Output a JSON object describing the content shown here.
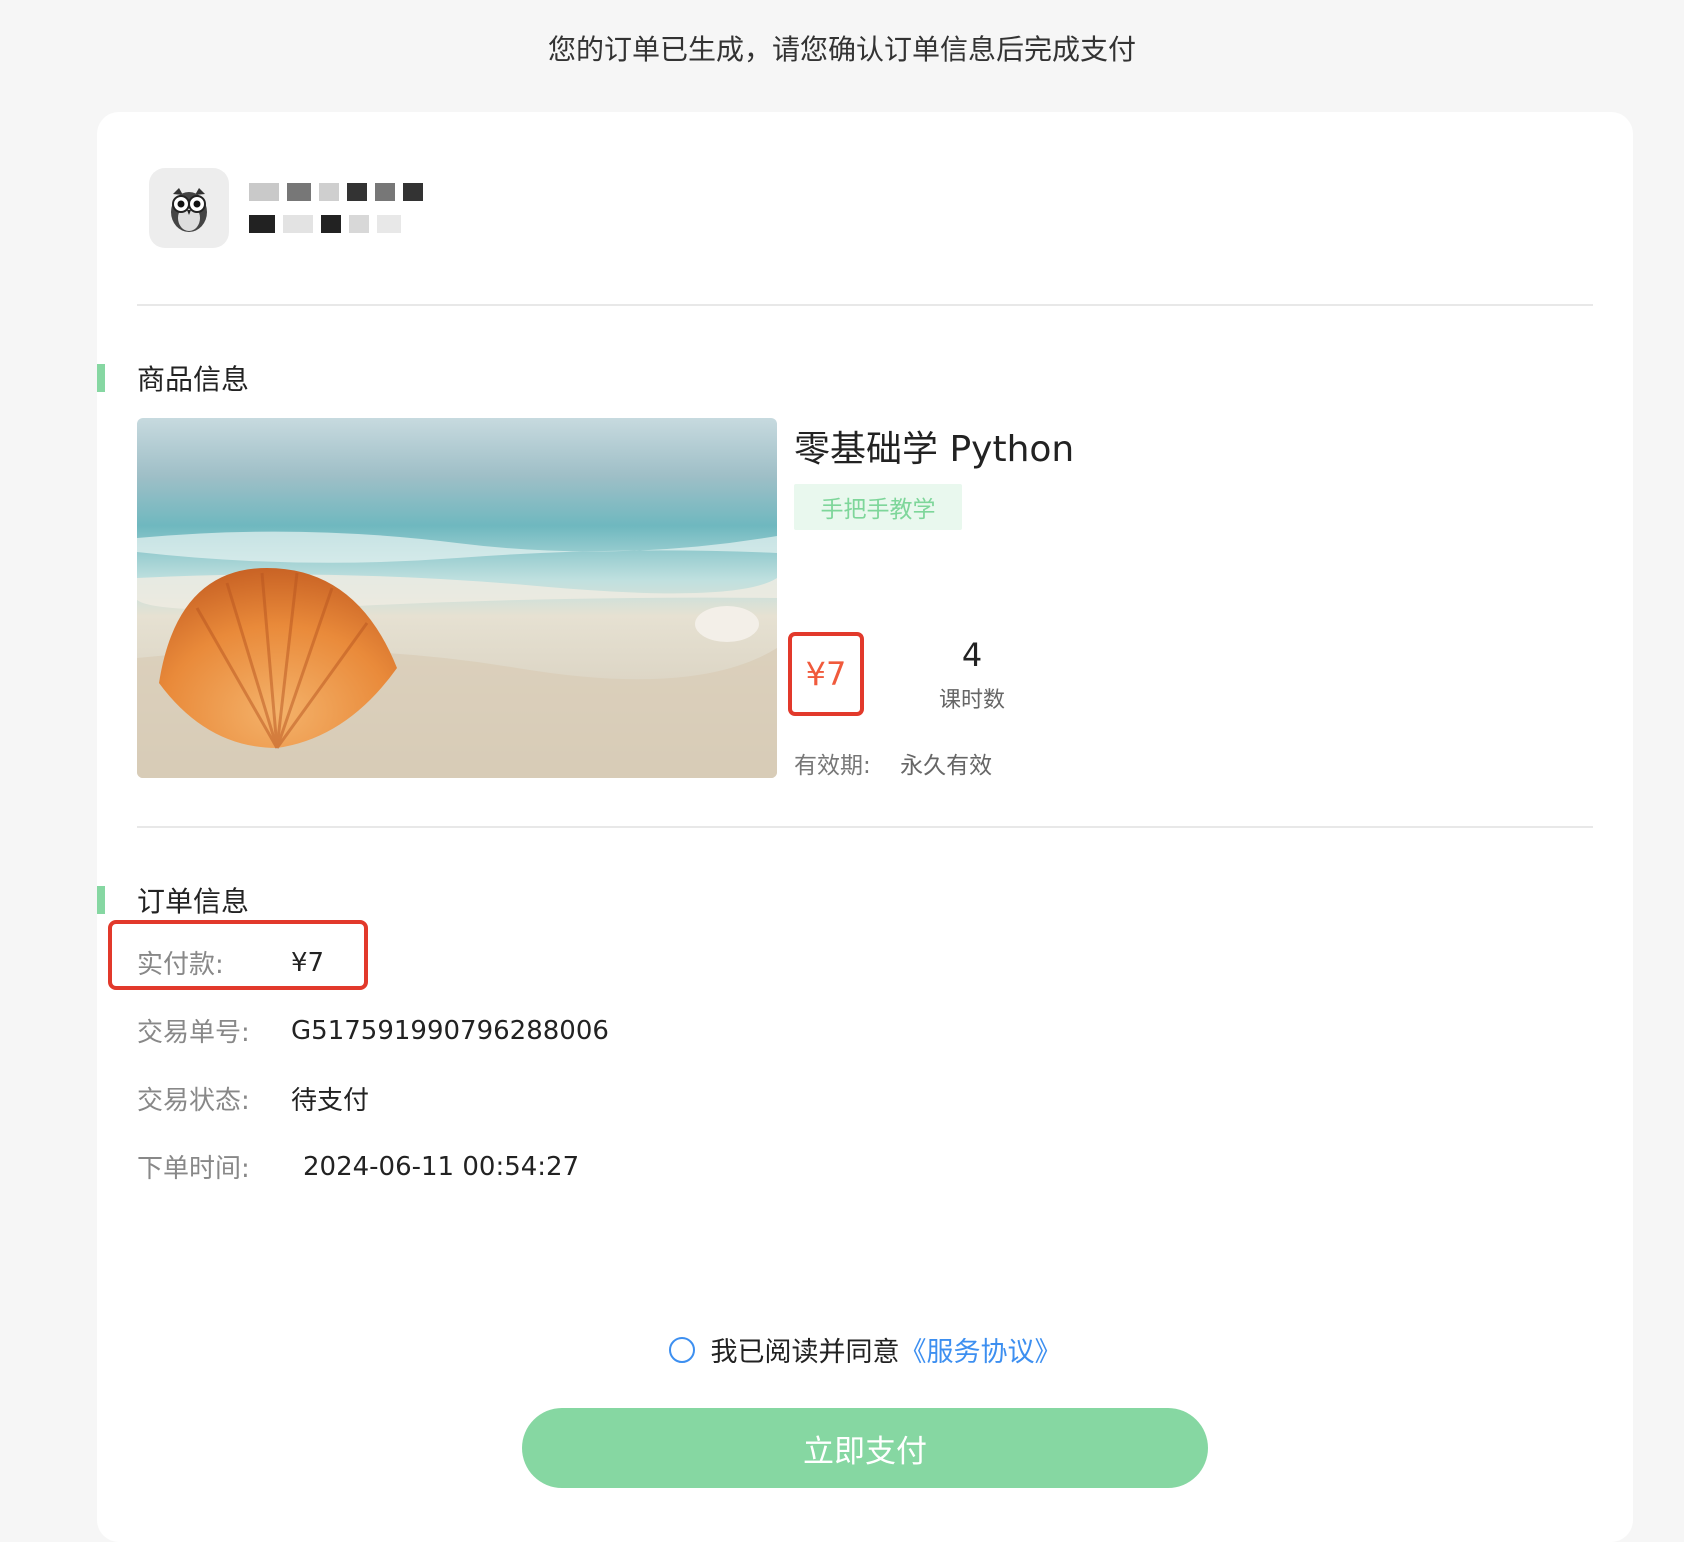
{
  "notice": "您的订单已生成，请您确认订单信息后完成支付",
  "shop": {
    "logo_icon": "owl-icon"
  },
  "product_section": {
    "title": "商品信息",
    "product": {
      "name": "零基础学 Python",
      "tag": "手把手教学",
      "price": "¥7",
      "lessons": "4",
      "lessons_label": "课时数",
      "validity_label": "有效期:",
      "validity_value": "永久有效",
      "image": "seashell-beach-image"
    }
  },
  "order_section": {
    "title": "订单信息",
    "paid_label": "实付款:",
    "paid_value": "¥7",
    "trade_no_label": "交易单号:",
    "trade_no_value": "G517591990796288006",
    "status_label": "交易状态:",
    "status_value": "待支付",
    "time_label": "下单时间:",
    "time_value": "2024-06-11 00:54:27"
  },
  "agreement": {
    "text": "我已阅读并同意",
    "link": "《服务协议》"
  },
  "pay_button": "立即支付",
  "colors": {
    "accent_green": "#86d7a2",
    "price_red": "#f05a3c",
    "highlight_border": "#e2392b",
    "link_blue": "#3d8ff0"
  }
}
